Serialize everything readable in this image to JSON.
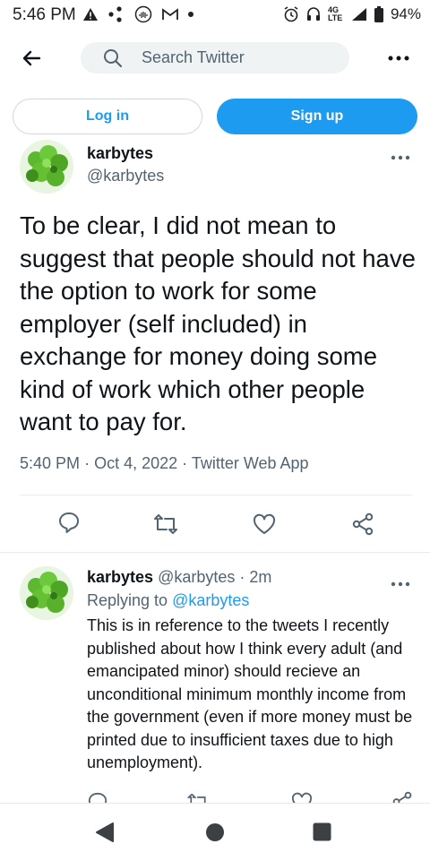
{
  "status_bar": {
    "time": "5:46 PM",
    "network": "4G LTE",
    "battery": "94%"
  },
  "header": {
    "search_placeholder": "Search Twitter"
  },
  "auth": {
    "login_label": "Log in",
    "signup_label": "Sign up"
  },
  "tweet": {
    "author_name": "karbytes",
    "author_handle": "@karbytes",
    "text": "To be clear, I did not mean to suggest that people should not have the option to work for some employer (self included) in exchange for money doing some kind of work which other people want to pay for.",
    "time": "5:40 PM",
    "date": "Oct 4, 2022",
    "source": "Twitter Web App"
  },
  "reply": {
    "author_name": "karbytes",
    "author_handle": "@karbytes",
    "age": "2m",
    "replying_prefix": "Replying to",
    "replying_to": "@karbytes",
    "text": "This is in reference to the tweets I recently published about how I think every adult (and emancipated minor) should recieve an unconditional minimum monthly income from the government (even if more money must be printed due to insufficient taxes due to high unemployment)."
  },
  "colors": {
    "accent": "#1d9bf0",
    "text_primary": "#0f1419",
    "text_secondary": "#536471"
  },
  "icons": {
    "back": "arrow-left-icon",
    "search": "search-icon",
    "more": "more-horizontal-icon",
    "reply": "reply-icon",
    "retweet": "retweet-icon",
    "like": "heart-icon",
    "share": "share-icon"
  }
}
